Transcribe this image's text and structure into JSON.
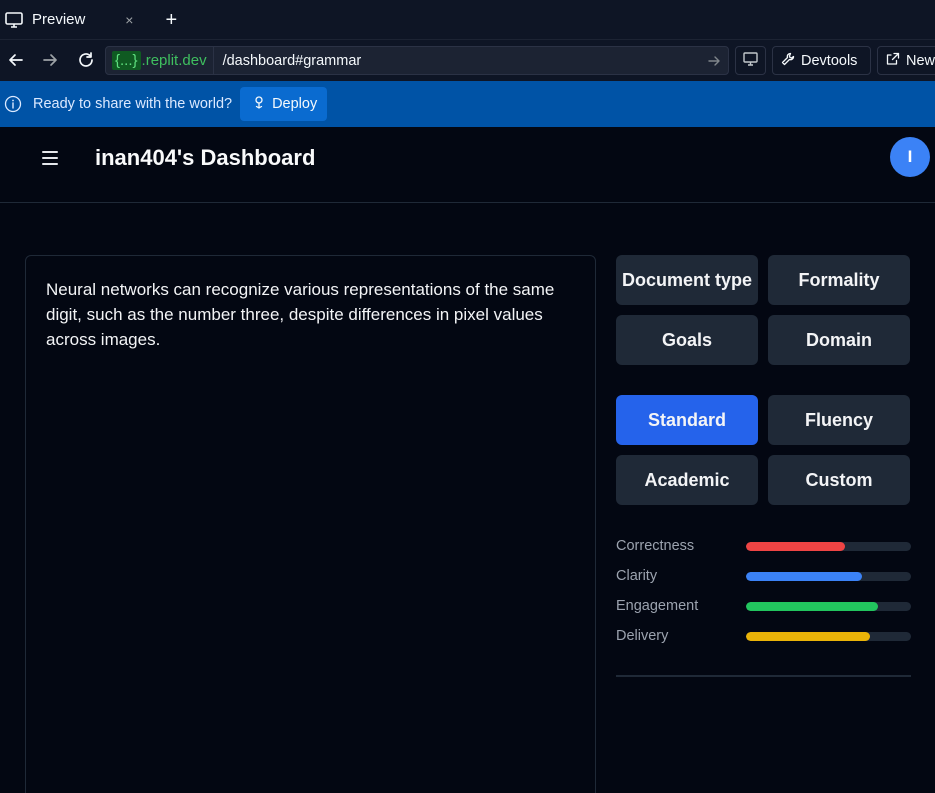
{
  "browser": {
    "tab_label": "Preview",
    "tab_close": "×",
    "tab_add": "+",
    "url_braces": "{...}",
    "url_host": ".replit.dev",
    "url_path": "/dashboard#grammar",
    "devtools_label": "Devtools",
    "new_tab_label": "New"
  },
  "deploy_banner": {
    "message": "Ready to share with the world?",
    "button_label": "Deploy"
  },
  "header": {
    "title": "inan404's Dashboard",
    "avatar_initial": "I"
  },
  "editor": {
    "text": "Neural networks can recognize various representations of the same digit, such as the number three, despite differences in pixel values across images."
  },
  "settings_options": [
    {
      "label": "Document type"
    },
    {
      "label": "Formality"
    },
    {
      "label": "Goals"
    },
    {
      "label": "Domain"
    }
  ],
  "mode_options": [
    {
      "label": "Standard",
      "active": true
    },
    {
      "label": "Fluency",
      "active": false
    },
    {
      "label": "Academic",
      "active": false
    },
    {
      "label": "Custom",
      "active": false
    }
  ],
  "metrics": [
    {
      "label": "Correctness",
      "fraction": 0.6,
      "color": "#ef4444"
    },
    {
      "label": "Clarity",
      "fraction": 0.7,
      "color": "#3b82f6"
    },
    {
      "label": "Engagement",
      "fraction": 0.8,
      "color": "#22c55e"
    },
    {
      "label": "Delivery",
      "fraction": 0.75,
      "color": "#eab308"
    }
  ]
}
